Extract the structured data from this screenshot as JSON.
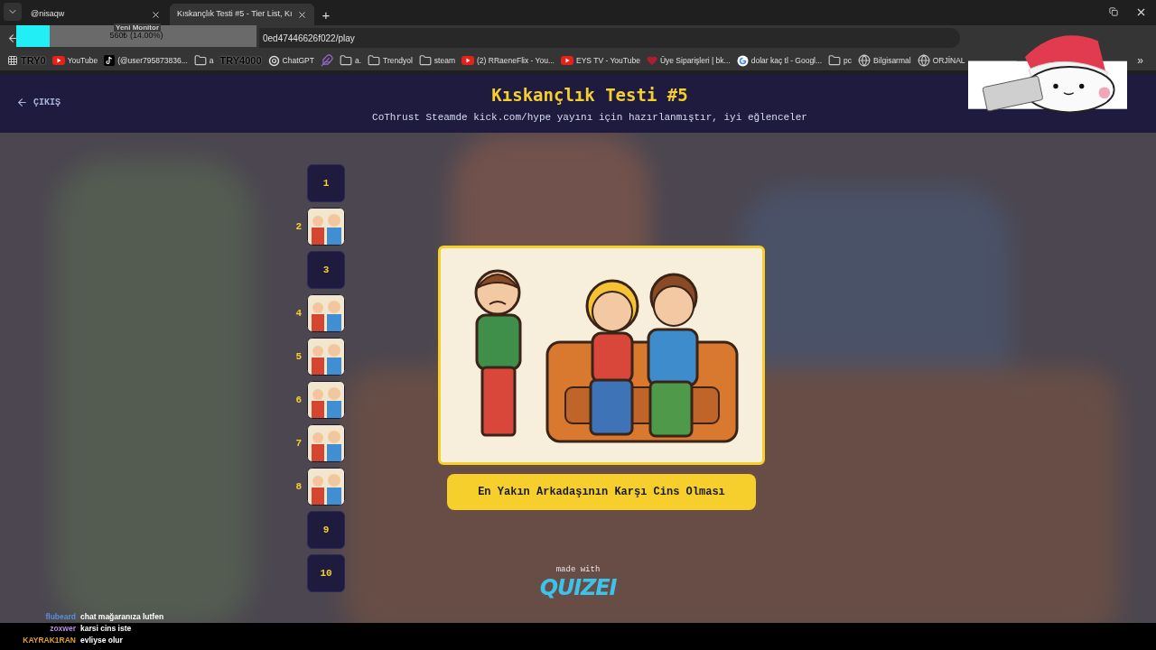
{
  "browser": {
    "tabs": [
      {
        "title": "@nisaqw",
        "selected": false
      },
      {
        "title": "Kıskançlık Testi #5 - Tier List, Kı",
        "selected": true
      }
    ],
    "new_tab": "+",
    "url": "0ed47446626f022/play",
    "bookmarks": [
      {
        "label": "YouTube",
        "kind": "youtube"
      },
      {
        "label": "(@user795873836...",
        "kind": "tiktok"
      },
      {
        "label": "a",
        "kind": "folder"
      },
      {
        "label": "ChatGPT",
        "kind": "chatgpt"
      },
      {
        "kind": "feather"
      },
      {
        "label": "a.",
        "kind": "folder"
      },
      {
        "label": "Trendyol",
        "kind": "folder"
      },
      {
        "label": "steam",
        "kind": "folder"
      },
      {
        "label": "(2) RRaeneFlix - You...",
        "kind": "youtube"
      },
      {
        "label": "EYS TV - YouTube",
        "kind": "youtube"
      },
      {
        "label": "Üye Siparişleri | bk...",
        "kind": "shop"
      },
      {
        "label": "dolar kaç tl - Googl...",
        "kind": "google"
      },
      {
        "label": "pc",
        "kind": "folder"
      },
      {
        "label": "Bilgisarmal",
        "kind": "globe"
      },
      {
        "label": "ORJİNAL",
        "kind": "globe"
      }
    ],
    "more_bookmarks": "»"
  },
  "stream_overlay": {
    "goal_title": "Yeni Monitor",
    "goal_progress": "560₺ (14.00%)",
    "level": 0.14,
    "goal_start": "TRY0",
    "goal_end": "TRY4000"
  },
  "page": {
    "back_link": "ÇIKIŞ",
    "title": "Kıskançlık Testi #5",
    "subtitle": "CoThrust Steamde kick.com/hype yayını için hazırlanmıştır, iyi eğlenceler",
    "tiers": [
      {
        "number": "1",
        "kind": "empty"
      },
      {
        "number": "2",
        "kind": "image"
      },
      {
        "number": "3",
        "kind": "empty"
      },
      {
        "number": "4",
        "kind": "image"
      },
      {
        "number": "5",
        "kind": "image"
      },
      {
        "number": "6",
        "kind": "image"
      },
      {
        "number": "7",
        "kind": "image"
      },
      {
        "number": "8",
        "kind": "image"
      },
      {
        "number": "9",
        "kind": "empty"
      },
      {
        "number": "10",
        "kind": "empty"
      }
    ],
    "current_item": {
      "caption": "En Yakın Arkadaşının Karşı Cins Olması"
    },
    "footer": {
      "made_with": "made with",
      "brand": "QUIZEI"
    }
  },
  "chat": [
    {
      "user": "flubeard",
      "message": "chat mağaranıza lutfen",
      "color": "#5b8fd6"
    },
    {
      "user": "zoxwer",
      "message": "karsi cins iste",
      "color": "#b58be0"
    },
    {
      "user": "KAYRAK1RAN",
      "message": "evliyse olur",
      "color": "#e0a030"
    }
  ]
}
